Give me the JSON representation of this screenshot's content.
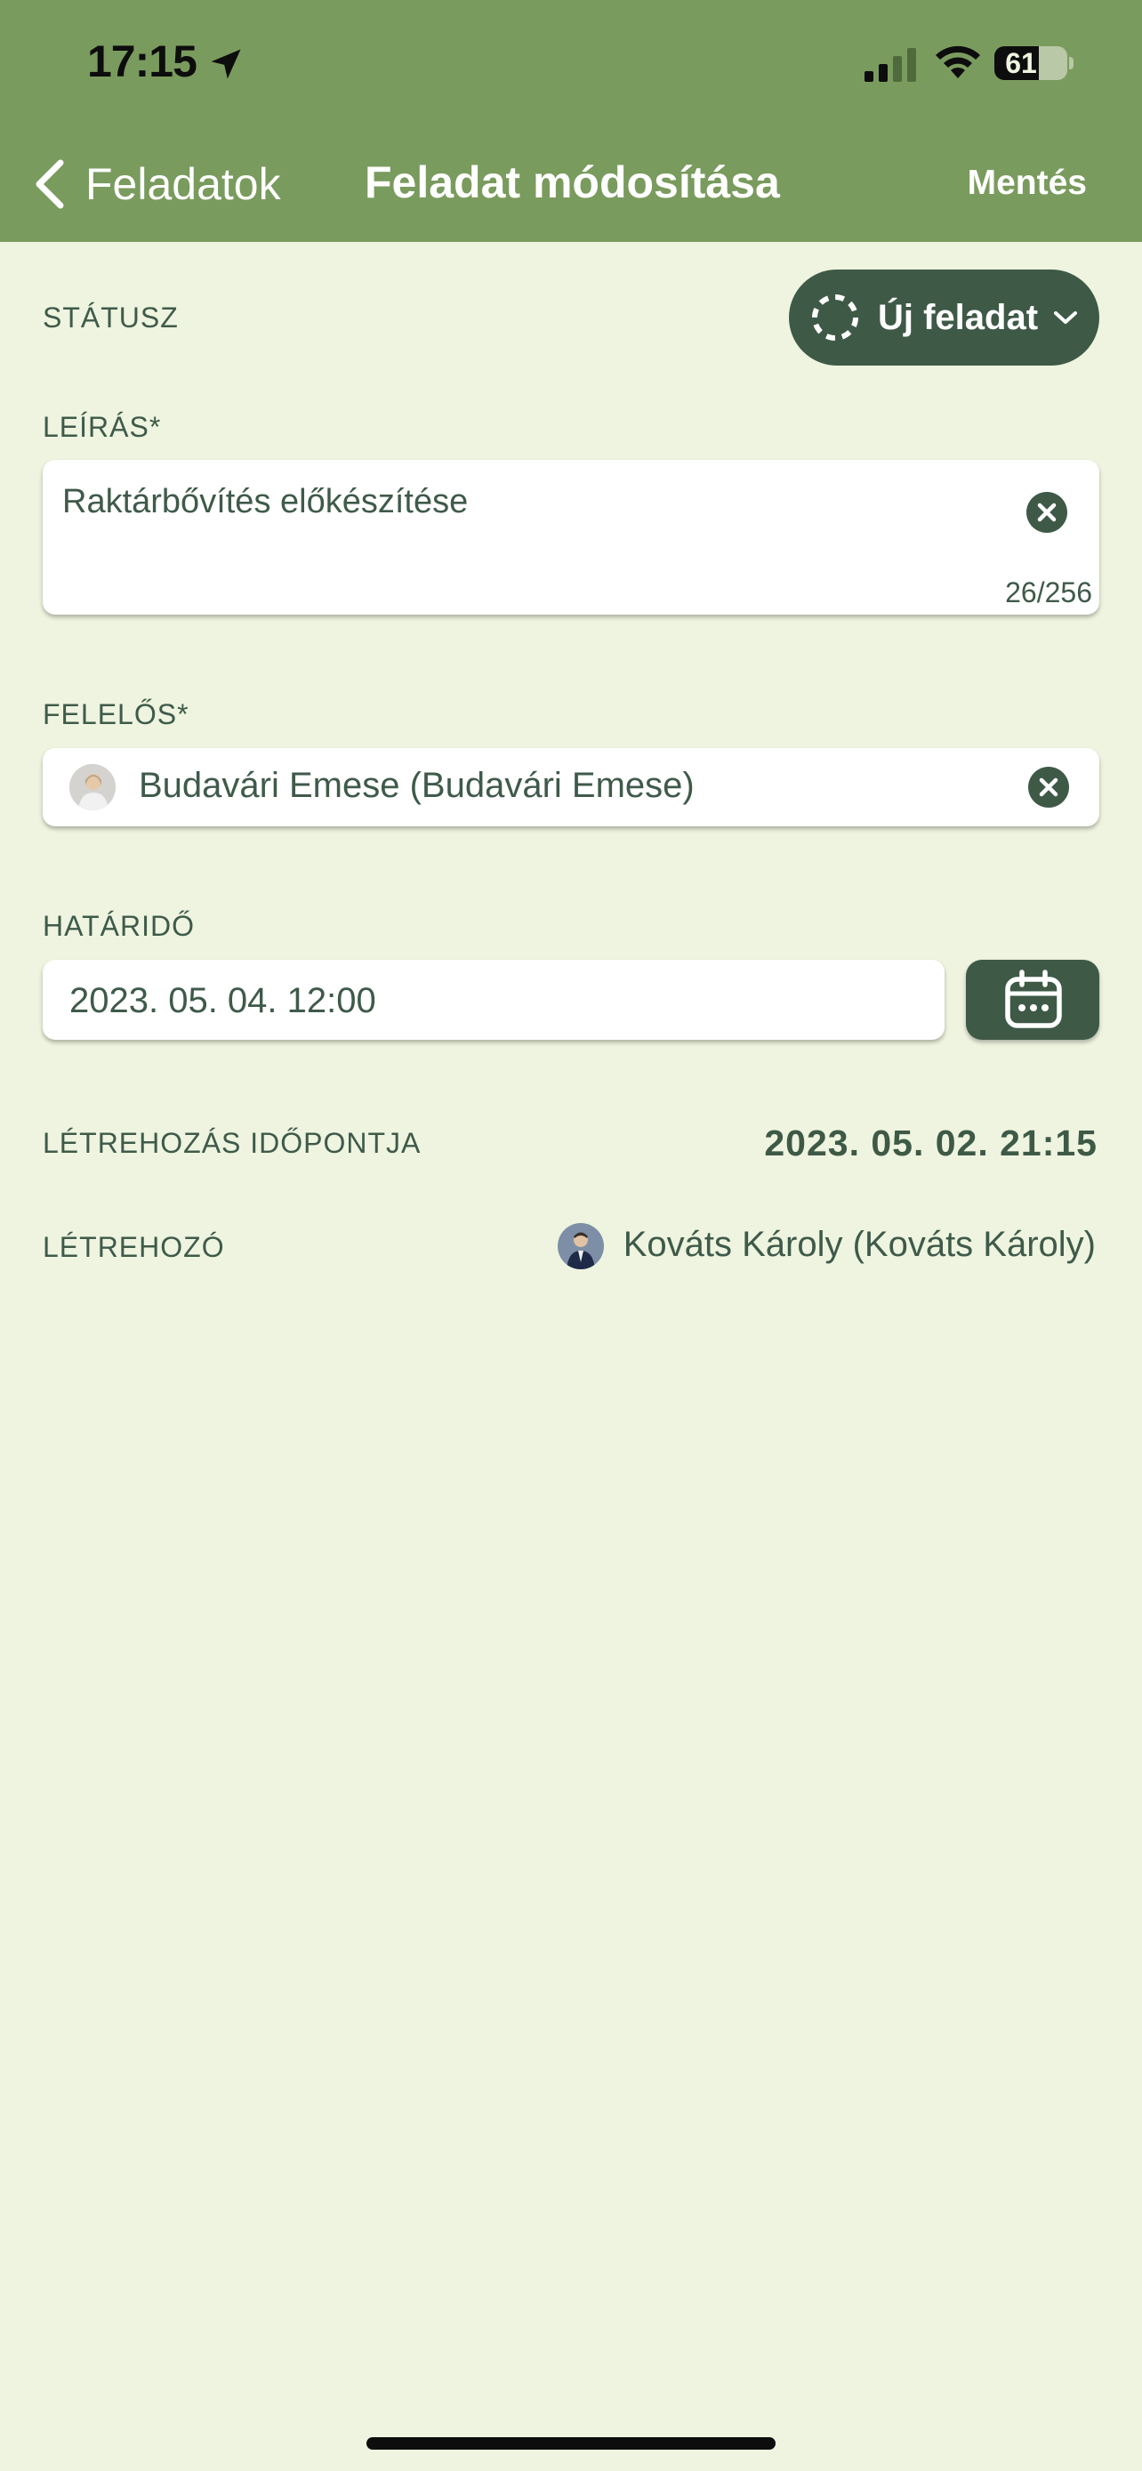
{
  "status_bar": {
    "time": "17:15",
    "battery": "61",
    "battery_level": 0.61
  },
  "nav": {
    "back_label": "Feladatok",
    "title": "Feladat módosítása",
    "save_label": "Mentés"
  },
  "status": {
    "label": "STÁTUSZ",
    "value": "Új feladat"
  },
  "description": {
    "label": "LEÍRÁS*",
    "value": "Raktárbővítés előkészítése",
    "counter": "26/256"
  },
  "responsible": {
    "label": "FELELŐS*",
    "value": "Budavári Emese (Budavári Emese)"
  },
  "deadline": {
    "label": "HATÁRIDŐ",
    "value": "2023. 05. 04. 12:00"
  },
  "created_at": {
    "label": "LÉTREHOZÁS IDŐPONTJA",
    "value": "2023. 05. 02. 21:15"
  },
  "creator": {
    "label": "LÉTREHOZÓ",
    "value": "Kováts Károly (Kováts Károly)"
  },
  "colors": {
    "header": "#7a9b5e",
    "background": "#eef4df",
    "accent": "#3e5a47"
  }
}
